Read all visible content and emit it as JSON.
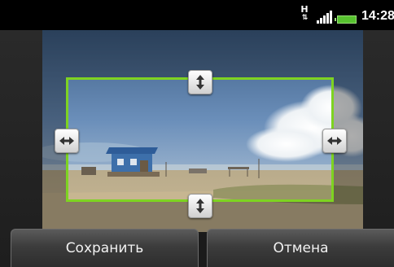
{
  "status_bar": {
    "network_type": "H",
    "network_arrows": "⇅",
    "signal_icon": "signal-icon",
    "battery_icon": "battery-icon",
    "battery_color": "#57c22f",
    "time": "14:28"
  },
  "photo": {
    "description_icon": "beach-photo",
    "crop_frame_color": "#7ed321"
  },
  "handles": {
    "top": "vertical-resize-icon",
    "bottom": "vertical-resize-icon",
    "left": "horizontal-resize-icon",
    "right": "horizontal-resize-icon"
  },
  "buttons": {
    "save_label": "Сохранить",
    "cancel_label": "Отмена"
  }
}
